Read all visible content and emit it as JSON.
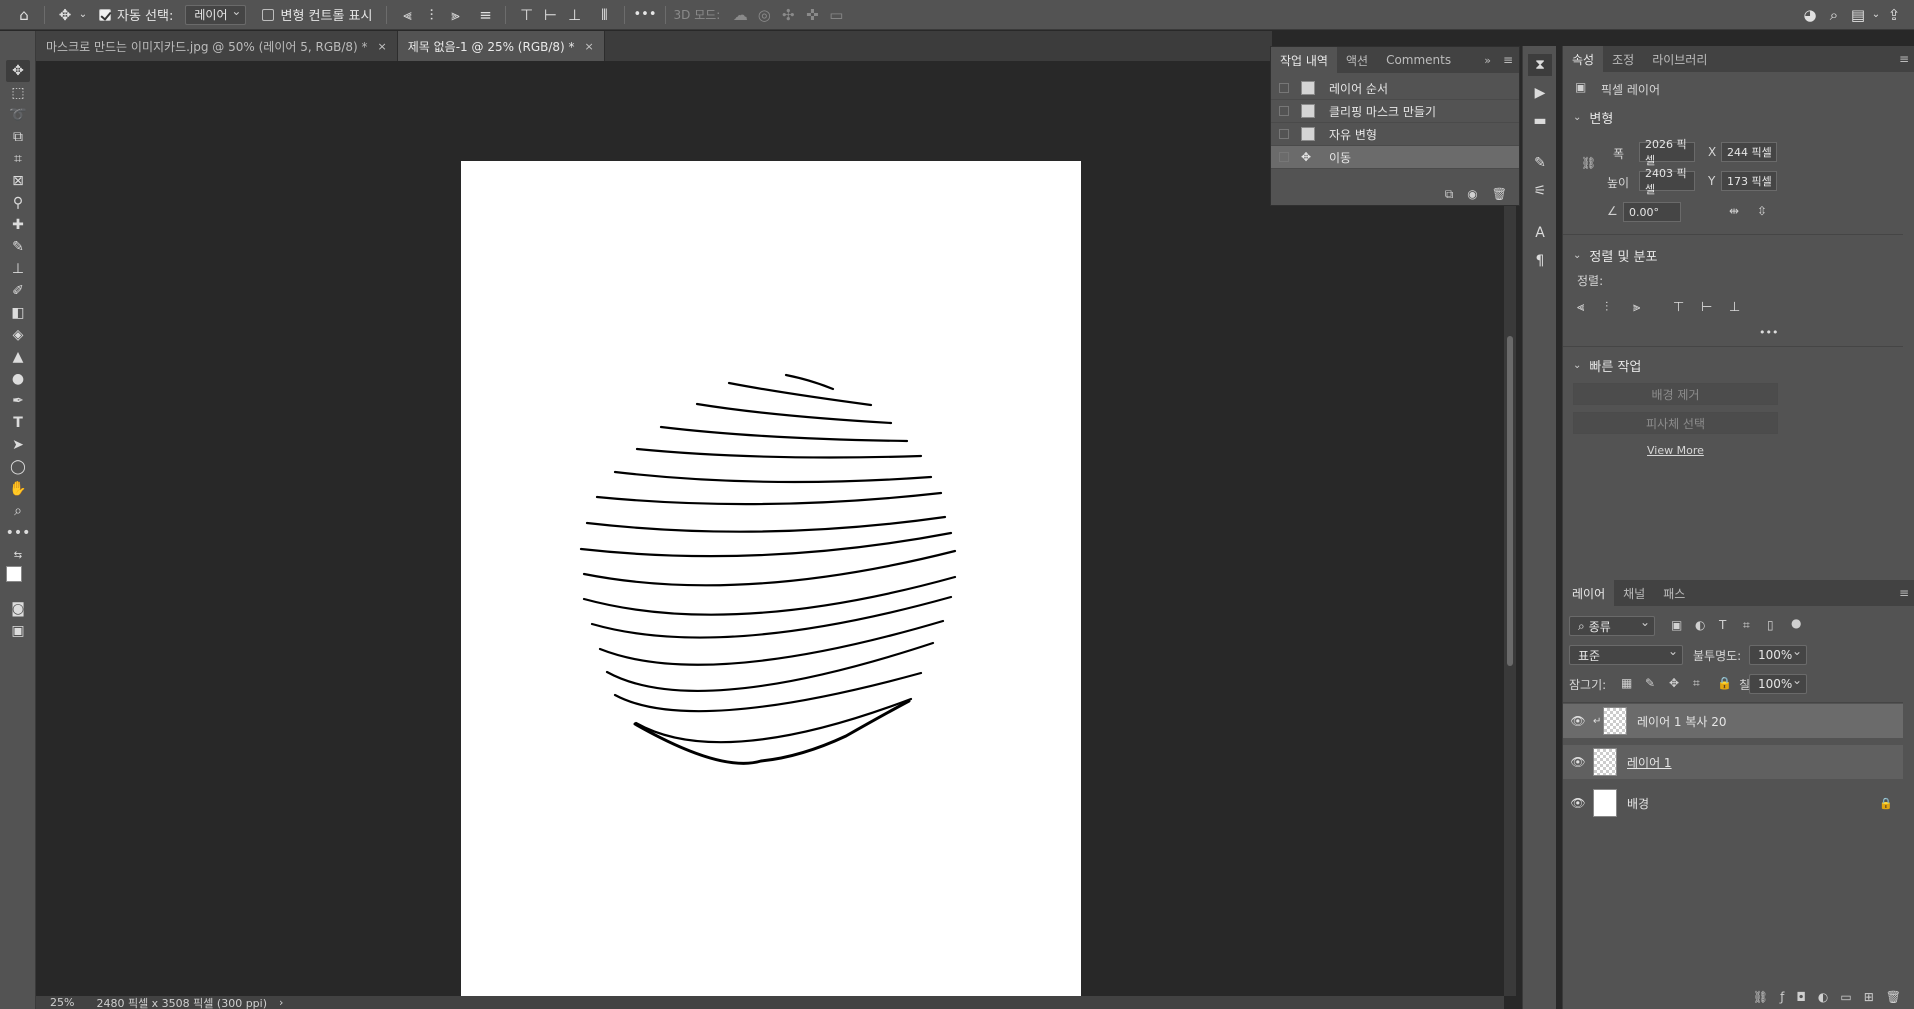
{
  "option_bar": {
    "auto_select_label": "자동 선택:",
    "auto_select_value": "레이어",
    "show_transform_label": "변형 컨트롤 표시",
    "three_d_mode_label": "3D 모드:",
    "more": "•••"
  },
  "tabs": [
    {
      "title": "마스크로 만드는 이미지카드.jpg @ 50% (레이어 5, RGB/8) *",
      "close": "×"
    },
    {
      "title": "제목 없음-1 @ 25% (RGB/8) *",
      "close": "×"
    }
  ],
  "status": {
    "zoom": "25%",
    "doc_info": "2480 픽셀 x 3508 픽셀 (300 ppi)",
    "arrow": "›"
  },
  "history_panel": {
    "tabs": [
      "작업 내역",
      "액션",
      "Comments"
    ],
    "items": [
      "레이어 순서",
      "클리핑 마스크 만들기",
      "자유 변형",
      "이동"
    ],
    "active_index": 3
  },
  "properties": {
    "tabs": [
      "속성",
      "조정",
      "라이브러리"
    ],
    "layer_kind": "픽셀 레이어",
    "transform_title": "변형",
    "w_label": "폭",
    "w_value": "2026 픽셀",
    "h_label": "높이",
    "h_value": "2403 픽셀",
    "x_label": "X",
    "x_value": "244 픽셀",
    "y_label": "Y",
    "y_value": "173 픽셀",
    "angle_value": "0.00°",
    "align_title": "정렬 및 분포",
    "align_label": "정렬:",
    "quick_title": "빠른 작업",
    "remove_bg": "배경 제거",
    "select_subject": "피사체 선택",
    "view_more": "View More",
    "more": "•••"
  },
  "layers_panel": {
    "tabs": [
      "레이어",
      "채널",
      "패스"
    ],
    "filter_label": "종류",
    "blend_mode": "표준",
    "opacity_label": "불투명도:",
    "opacity_value": "100%",
    "lock_label": "잠그기:",
    "fill_label": "칠:",
    "fill_value": "100%",
    "layers": [
      {
        "name": "레이어 1 복사 20"
      },
      {
        "name": "레이어 1"
      },
      {
        "name": "배경"
      }
    ]
  },
  "colors": {
    "ui_bg": "#535353",
    "canvas_bg": "#282828",
    "document": "#ffffff",
    "selection": "#6b6b6b"
  }
}
